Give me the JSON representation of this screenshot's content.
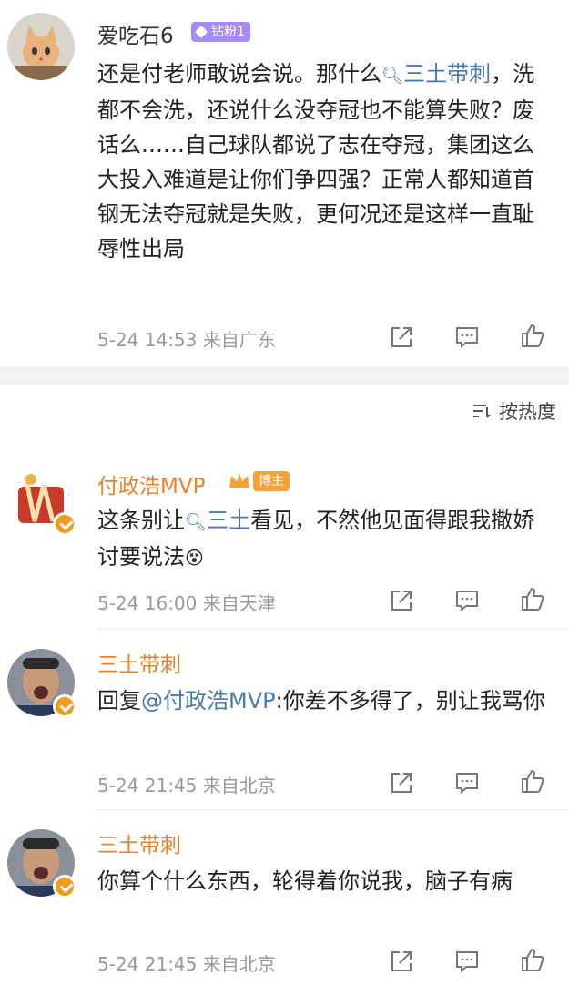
{
  "post1": {
    "username": "爱吃石6",
    "badge": "钻粉1",
    "text_pre": "还是付老师敢说会说。那什么",
    "mention": "三土带刺",
    "text_post": "，洗都不会洗，还说什么没夺冠也不能算失败？废话么……自己球队都说了志在夺冠，集团这么大投入难道是让你们争四强？正常人都知道首钢无法夺冠就是失败，更何况还是这样一直耻辱性出局",
    "meta": "5-24 14:53 来自广东"
  },
  "sort_label": "按热度",
  "comments": [
    {
      "username": "付政浩MVP",
      "badge": "博主",
      "text_pre": "这条别让",
      "mention": "三土",
      "text_post": "看见，不然他见面得跟我撒娇讨要说法",
      "emoji": "😵",
      "meta": "5-24 16:00 来自天津"
    },
    {
      "username": "三土带刺",
      "text_pre": "回复",
      "mention": "@付政浩MVP",
      "text_post": ":你差不多得了，别让我骂你",
      "meta": "5-24 21:45 来自北京"
    },
    {
      "username": "三土带刺",
      "text": "你算个什么东西，轮得着你说我，脑子有病",
      "meta": "5-24 21:45 来自北京"
    }
  ],
  "colors": {
    "name_orange": "#e8822e",
    "link_blue": "#4a78b0",
    "meta_gray": "#999999"
  }
}
